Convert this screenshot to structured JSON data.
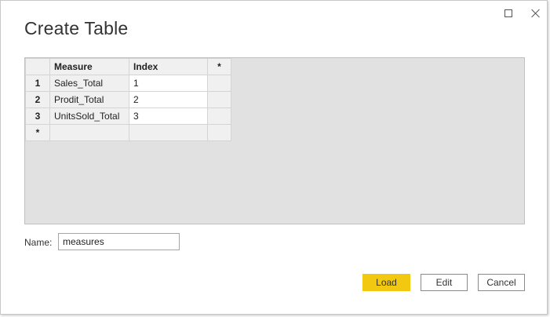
{
  "window": {
    "title": "Create Table"
  },
  "table": {
    "corner": "",
    "headers": [
      "Measure",
      "Index",
      "*"
    ],
    "rows": [
      {
        "num": "1",
        "measure": "Sales_Total",
        "index": "1"
      },
      {
        "num": "2",
        "measure": "Prodit_Total",
        "index": "2"
      },
      {
        "num": "3",
        "measure": "UnitsSold_Total",
        "index": "3"
      },
      {
        "num": "*",
        "measure": "",
        "index": ""
      }
    ]
  },
  "name_field": {
    "label": "Name:",
    "value": "measures"
  },
  "buttons": {
    "load": "Load",
    "edit": "Edit",
    "cancel": "Cancel"
  },
  "colors": {
    "accent": "#f2c811",
    "grid_background": "#e1e1e1"
  },
  "icons": {
    "maximize": "maximize-icon",
    "close": "close-icon"
  }
}
